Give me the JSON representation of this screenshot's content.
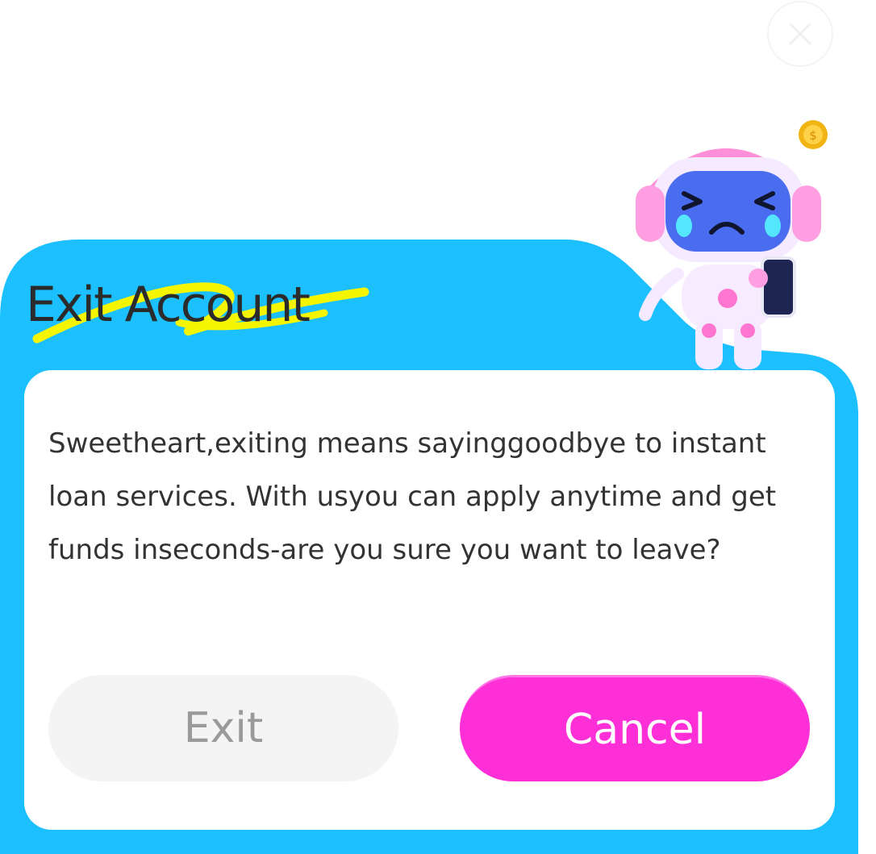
{
  "dialog": {
    "title": "Exit Account",
    "message": "Sweetheart,exiting means sayinggoodbye to instant loan services. With usyou can apply anytime and get funds inseconds-are you sure you want to leave?",
    "exit_label": "Exit",
    "cancel_label": "Cancel"
  },
  "icons": {
    "close": "close-icon",
    "mascot": "crying-robot-mascot",
    "coin": "gold-coin-icon",
    "phone": "phone-icon"
  },
  "colors": {
    "header": "#1cc0ff",
    "card": "#ffffff",
    "cancel_button": "#ff2fd8",
    "exit_button": "#f4f4f4",
    "title_highlight": "#f5f500"
  }
}
